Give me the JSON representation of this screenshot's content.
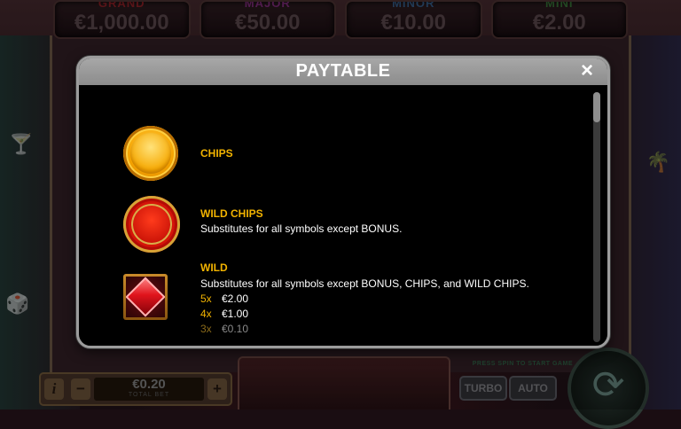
{
  "jackpots": [
    {
      "label": "GRAND",
      "value": "€1,000.00",
      "color": "#d8252b"
    },
    {
      "label": "MAJOR",
      "value": "€50.00",
      "color": "#c23ac4"
    },
    {
      "label": "MINOR",
      "value": "€10.00",
      "color": "#3d8fd8"
    },
    {
      "label": "MINI",
      "value": "€2.00",
      "color": "#3fb54a"
    }
  ],
  "paytable": {
    "title": "PAYTABLE",
    "close_icon": "×",
    "symbols": [
      {
        "name": "CHIPS",
        "icon": "gold-chip-icon"
      },
      {
        "name": "WILD CHIPS",
        "icon": "red-chip-icon",
        "description": "Substitutes for all symbols except BONUS."
      },
      {
        "name": "WILD",
        "icon": "ruby-wild-icon",
        "description": "Substitutes for all symbols except BONUS, CHIPS, and WILD CHIPS.",
        "pays": [
          {
            "multiplier": "5x",
            "amount": "€2.00"
          },
          {
            "multiplier": "4x",
            "amount": "€1.00"
          },
          {
            "multiplier": "3x",
            "amount": "€0.10"
          }
        ]
      }
    ]
  },
  "bottom": {
    "info": "i",
    "minus": "−",
    "plus": "+",
    "bet_value": "€0.20",
    "bet_label": "TOTAL BET",
    "hint": "PRESS SPIN TO START GAME",
    "turbo": "TURBO",
    "auto": "AUTO",
    "spin_icon": "⟳"
  },
  "colors": {
    "accent": "#f2b300",
    "modal_border": "#9c9c9c",
    "modal_bg": "#000000"
  }
}
